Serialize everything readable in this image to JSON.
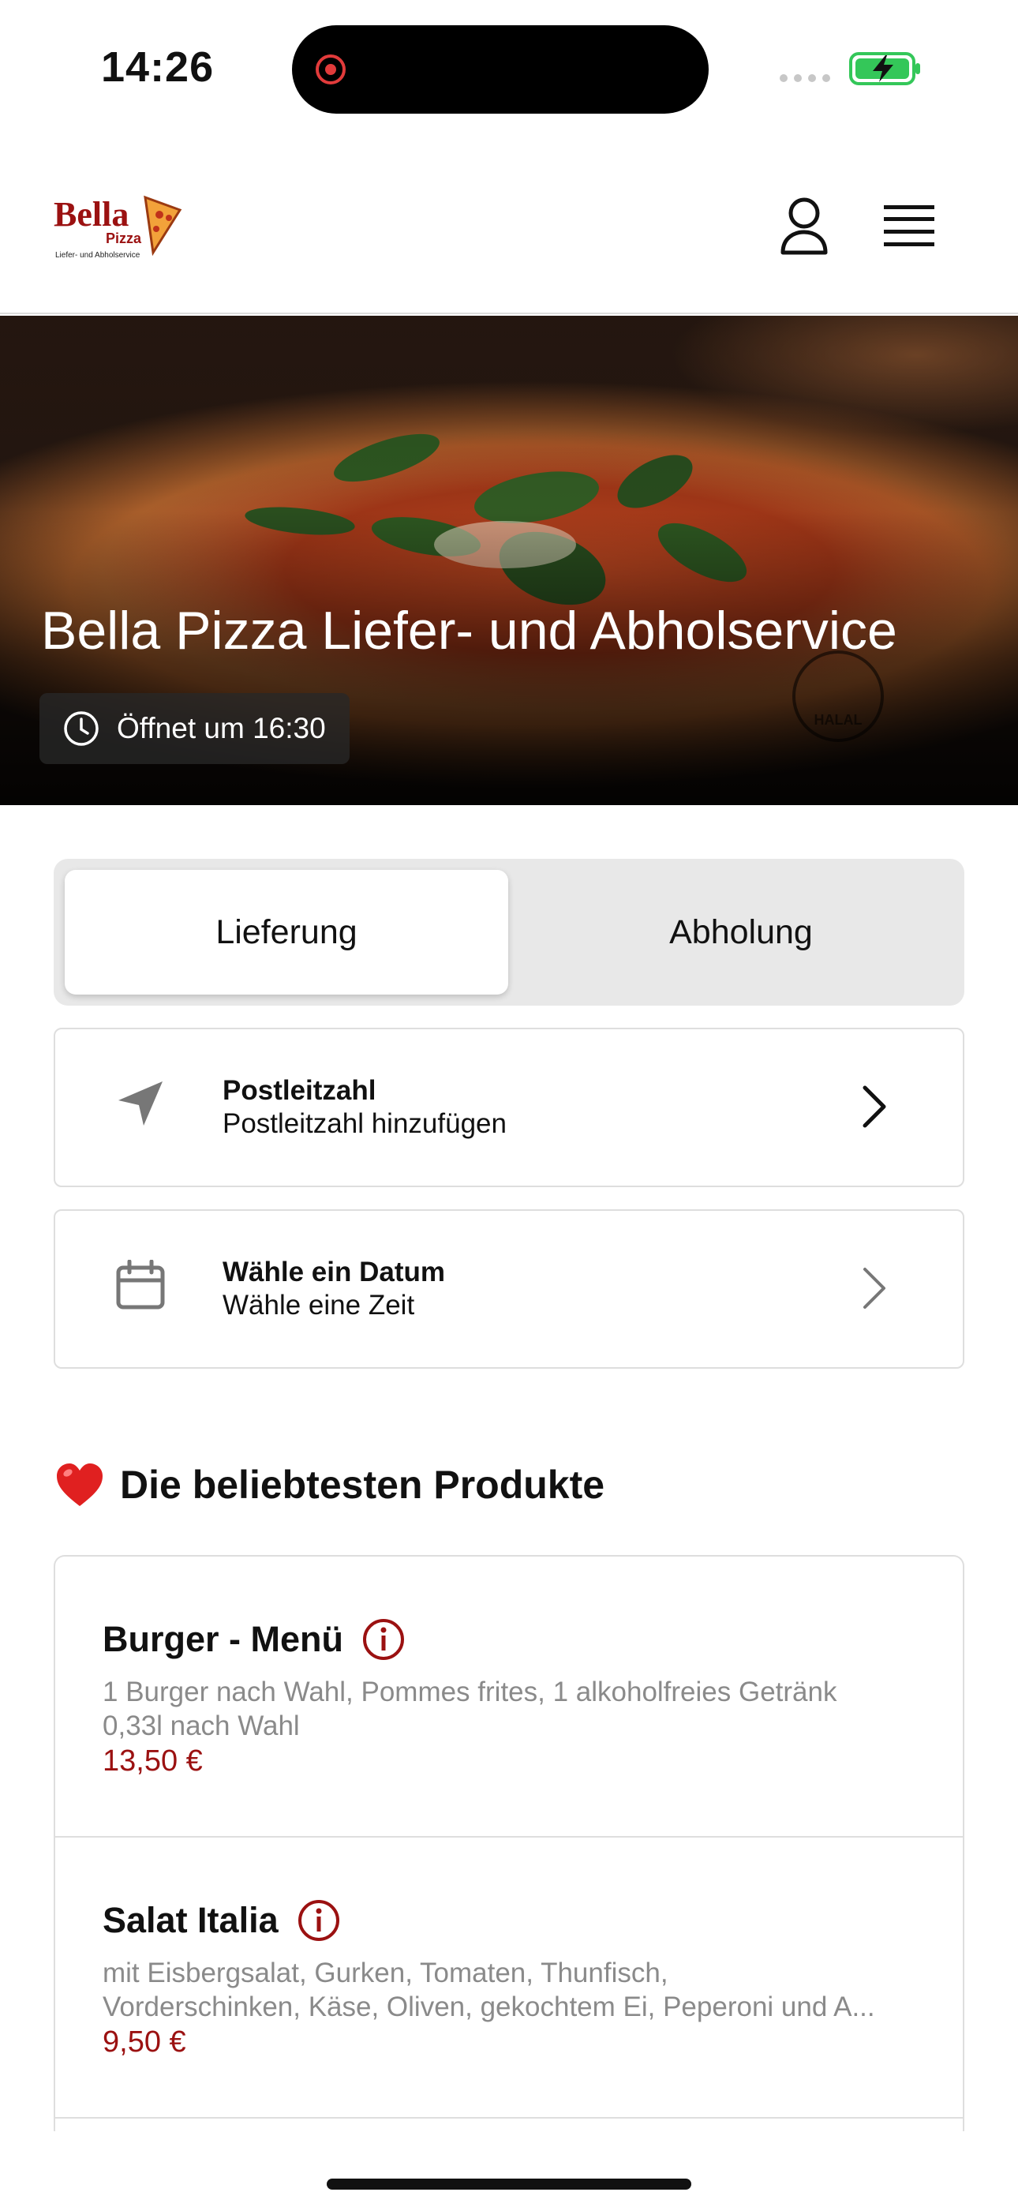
{
  "status_bar": {
    "time": "14:26",
    "battery_icon": "battery-charging-icon",
    "battery_color": "#34c759"
  },
  "header": {
    "logo_text": "Bella",
    "logo_sub": "Pizza",
    "logo_tagline": "Liefer- und Abholservice",
    "logo_color": "#9b1111"
  },
  "hero": {
    "title": "Bella Pizza Liefer- und Abholservice",
    "open_text": "Öffnet um 16:30",
    "halal_text": "HALAL"
  },
  "order_mode": {
    "options": [
      "Lieferung",
      "Abholung"
    ],
    "selected": "Lieferung"
  },
  "postal": {
    "title": "Postleitzahl",
    "subtitle": "Postleitzahl hinzufügen"
  },
  "date": {
    "title": "Wähle ein Datum",
    "subtitle": "Wähle eine Zeit"
  },
  "section": {
    "emoji": "❤️",
    "title": "Die beliebtesten Produkte"
  },
  "products": [
    {
      "name": "Burger - Menü",
      "description": "1 Burger nach Wahl, Pommes frites, 1 alkoholfreies Getränk\n0,33l nach Wahl",
      "price": "13,50 €"
    },
    {
      "name": "Salat Italia",
      "description": "mit Eisbergsalat, Gurken, Tomaten, Thunfisch,\nVorderschinken, Käse, Oliven, gekochtem Ei, Peperoni und A...",
      "price": "9,50 €"
    }
  ],
  "accent_color": "#9b1111"
}
